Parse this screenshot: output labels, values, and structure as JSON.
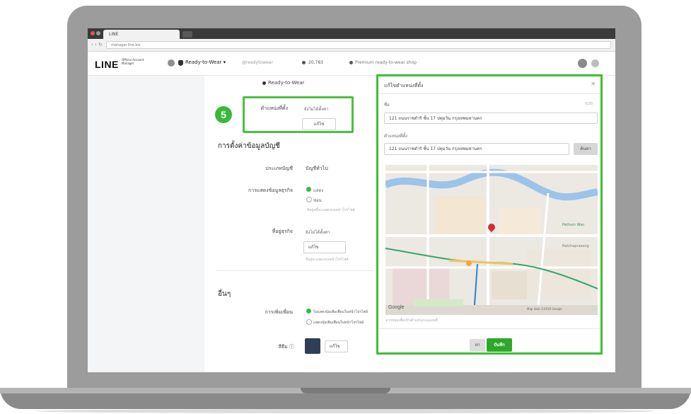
{
  "browser": {
    "tab_title": "LINE",
    "url": "manager.line.biz",
    "nav_icons": "‹ › ↻"
  },
  "header": {
    "logo": "LINE",
    "logo_sub": "Official Account Manager",
    "account_name": "Ready-to-Wear ▾",
    "account_id": "@readytowear",
    "friends_count": "20,783",
    "status_text": "Premium ready-to-wear shop"
  },
  "form": {
    "account_heading": "Ready-to-Wear",
    "location_label": "ตำแหน่งที่ตั้ง",
    "location_hint": "ยังไม่ได้ตั้งค่า",
    "location_button": "แก้ไข",
    "section_title": "การตั้งค่าข้อมูลบัญชี",
    "account_type_label": "ประเภทบัญชี",
    "account_type_value": "บัญชีทั่วไป",
    "display_label": "การแสดงข้อมูลธุรกิจ",
    "display_option_on": "แสดง",
    "display_option_off": "ซ่อน",
    "display_hint": "ข้อมูลนี้จะแสดงบนหน้าโปรไฟล์",
    "address_label": "ที่อยู่ธุรกิจ",
    "address_hint": "ยังไม่ได้ตั้งค่า",
    "address_button": "แก้ไข",
    "address_note": "ที่อยู่จะแสดงบนหน้าโปรไฟล์",
    "other_section": "อื่นๆ",
    "friend_add_label": "การเพิ่มเพื่อน",
    "friend_add_on": "ไม่แสดงปุ่มเพิ่มเพื่อนในหน้าโปรไฟล์",
    "friend_add_off": "แสดงปุ่มเพิ่มเพื่อนในหน้าโปรไฟล์",
    "color_label": "สีธีม ⓘ",
    "color_button": "แก้ไข"
  },
  "panel": {
    "title": "แก้ไขตำแหน่งที่ตั้ง",
    "close": "×",
    "name_label": "ชื่อ",
    "name_count": "0/20",
    "name_value": "121 ถนนราชดำริ ชั้น 17 ปทุมวัน กรุงเทพมหานคร",
    "address_label": "ตำแหน่งที่ตั้ง",
    "address_value": "121 ถนนราชดำริ ชั้น 17 ปทุมวัน กรุงเทพมหานคร",
    "search_button": "ค้นหา",
    "map_google": "Google",
    "map_attrib": "Map data ©2019 Google",
    "map_label_a": "Pathum Wan",
    "map_label_b": "Ratchaprasong",
    "map_hint": "ลากหมุดเพื่อปรับตำแหน่งบนแผนที่",
    "cancel": "ยก",
    "save": "บันทึก"
  },
  "step_number": "5",
  "colors": {
    "accent_green": "#3fbf34",
    "theme_swatch": "#2f3e57"
  }
}
